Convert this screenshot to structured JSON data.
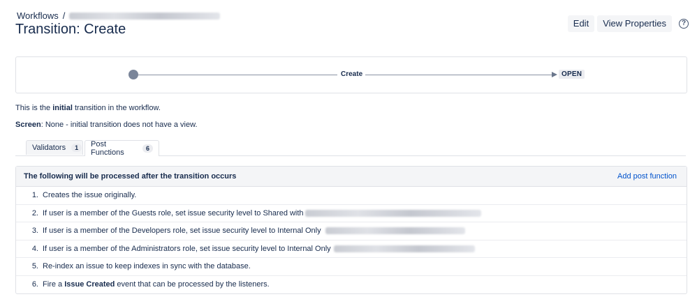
{
  "breadcrumb": {
    "root": "Workflows",
    "separator": "/"
  },
  "page": {
    "title": "Transition: Create"
  },
  "actions": {
    "edit": "Edit",
    "view_properties": "View Properties",
    "help_glyph": "?"
  },
  "diagram": {
    "transition": "Create",
    "target_status": "OPEN"
  },
  "info": {
    "line1_prefix": "This is the ",
    "line1_bold": "initial",
    "line1_suffix": " transition in the workflow.",
    "screen_label": "Screen",
    "screen_value": ": None - initial transition does not have a view."
  },
  "tabs": [
    {
      "label": "Validators",
      "count": "1"
    },
    {
      "label": "Post Functions",
      "count": "6"
    }
  ],
  "panel": {
    "header": "The following will be processed after the transition occurs",
    "add_link": "Add post function",
    "steps": [
      {
        "num": "1.",
        "text": "Creates the issue originally."
      },
      {
        "num": "2.",
        "text": "If user is a member of the Guests role, set issue security level to Shared with"
      },
      {
        "num": "3.",
        "text": "If user is a member of the Developers role, set issue security level to Internal Only"
      },
      {
        "num": "4.",
        "text": "If user is a member of the Administrators role, set issue security level to Internal Only"
      },
      {
        "num": "5.",
        "text": "Re-index an issue to keep indexes in sync with the database."
      },
      {
        "num": "6.",
        "pre": "Fire a ",
        "bold": "Issue Created",
        "post": " event that can be processed by the listeners."
      }
    ]
  },
  "colors": {
    "link": "#0052cc",
    "text": "#172b4d",
    "border": "#dfe1e6",
    "dot": "#7a8599"
  }
}
